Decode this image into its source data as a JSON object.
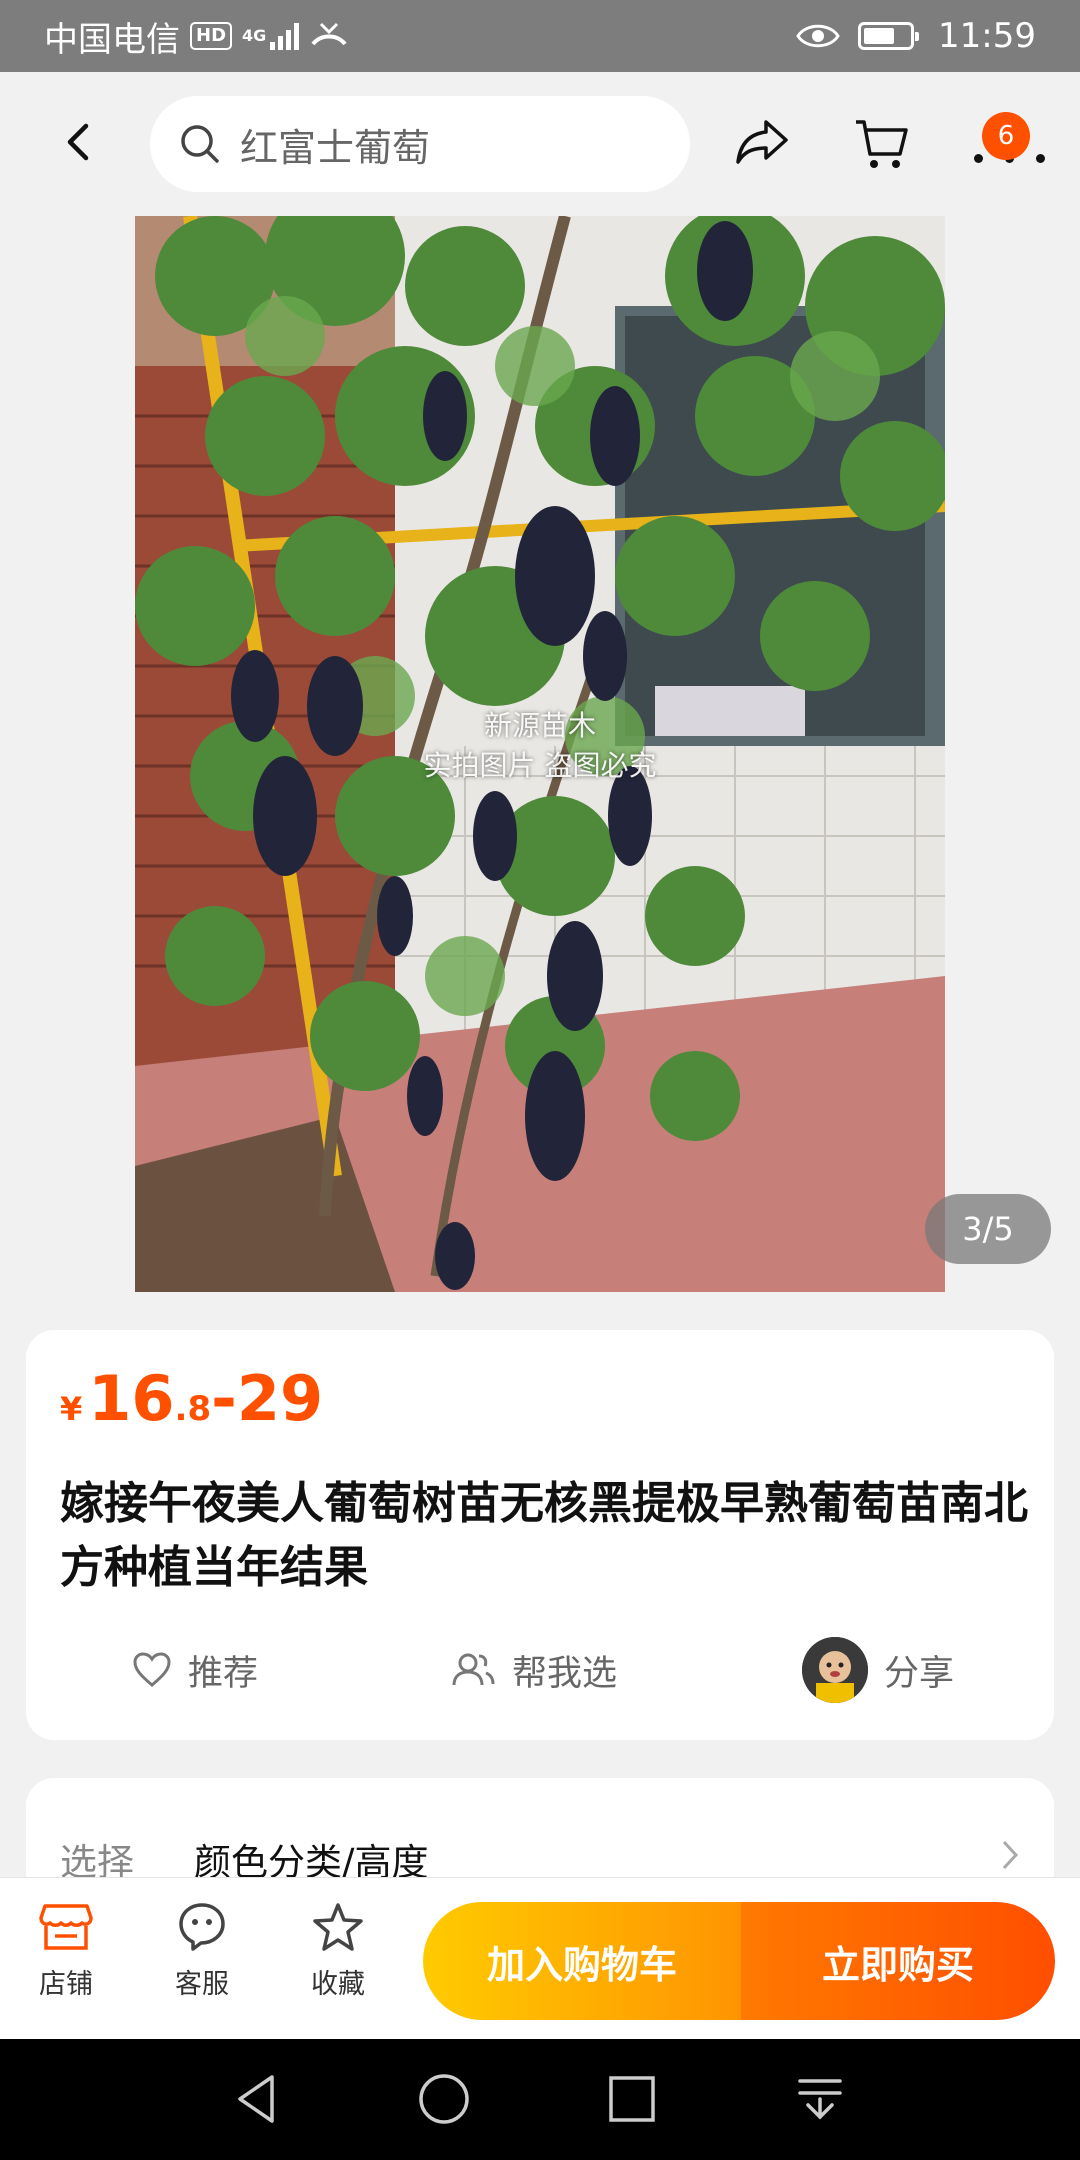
{
  "status_bar": {
    "carrier": "中国电信",
    "hd": "HD",
    "network": "4G",
    "time": "11:59"
  },
  "header": {
    "search_text": "红富士葡萄",
    "cart_badge": "6"
  },
  "gallery": {
    "counter": "3/5",
    "watermark_line1": "新源苗木",
    "watermark_line2": "实拍图片 盗图必究"
  },
  "product": {
    "currency": "¥",
    "price_low_int": "16",
    "price_low_dec": ".8",
    "price_sep": "-",
    "price_high": "29",
    "title": "嫁接午夜美人葡萄树苗无核黑提极早熟葡萄苗南北方种植当年结果"
  },
  "actions": {
    "recommend": "推荐",
    "help_choose": "帮我选",
    "share": "分享"
  },
  "select": {
    "label": "选择",
    "value": "颜色分类/高度"
  },
  "bottom_bar": {
    "shop": "店铺",
    "service": "客服",
    "favorite": "收藏",
    "add_to_cart": "加入购物车",
    "buy_now": "立即购买"
  },
  "colors": {
    "accent": "#ff5000",
    "cart_gradient_start": "#ffcb00",
    "buy_gradient_end": "#ff4e00"
  }
}
